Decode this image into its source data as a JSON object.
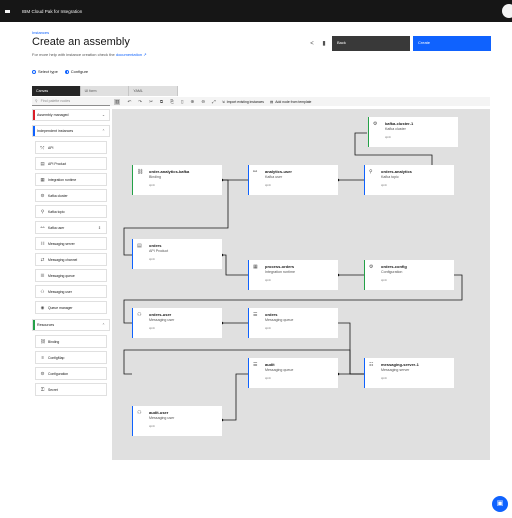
{
  "topbar": {
    "title": "IBM Cloud Pak for Integration"
  },
  "header": {
    "breadcrumb": "Instances",
    "title": "Create an assembly",
    "help_prefix": "For more help with instance creation check the",
    "help_link": "documentation",
    "back_label": "Back",
    "create_label": "Create"
  },
  "steps": [
    {
      "label": "Select type"
    },
    {
      "label": "Configure"
    }
  ],
  "tabs": [
    {
      "label": "Canvas"
    },
    {
      "label": "UI form"
    },
    {
      "label": "YAML"
    }
  ],
  "toolbar": {
    "search_placeholder": "Find palette nodes",
    "import_label": "Import existing instances",
    "add_template_label": "Add node from template"
  },
  "palette": {
    "assembly_managed": "Assembly managed",
    "independent_instances": "Independent instances",
    "independent_items": [
      {
        "label": "API",
        "icon": "api-icon"
      },
      {
        "label": "API Product",
        "icon": "api-product-icon"
      },
      {
        "label": "Integration runtime",
        "icon": "integration-runtime-icon"
      },
      {
        "label": "Kafka cluster",
        "icon": "kafka-cluster-icon"
      },
      {
        "label": "Kafka topic",
        "icon": "kafka-topic-icon"
      },
      {
        "label": "Kafka user",
        "icon": "kafka-user-icon"
      },
      {
        "label": "Messaging server",
        "icon": "messaging-server-icon"
      },
      {
        "label": "Messaging channel",
        "icon": "messaging-channel-icon"
      },
      {
        "label": "Messaging queue",
        "icon": "messaging-queue-icon"
      },
      {
        "label": "Messaging user",
        "icon": "messaging-user-icon"
      },
      {
        "label": "Queue manager",
        "icon": "queue-manager-icon"
      }
    ],
    "resources": "Resources",
    "resource_items": [
      {
        "label": "Binding",
        "icon": "binding-icon"
      },
      {
        "label": "ConfigMap",
        "icon": "configmap-icon"
      },
      {
        "label": "Configuration",
        "icon": "configuration-icon"
      },
      {
        "label": "Secret",
        "icon": "secret-icon"
      }
    ]
  },
  "nodes": {
    "kafka_cluster_1": {
      "name": "kafka-cluster-1",
      "type": "Kafka cluster",
      "sub": "cp4i"
    },
    "order_analytics_kafka": {
      "name": "order-analytics-kafka",
      "type": "Binding",
      "sub": "cp4i"
    },
    "analytics_user": {
      "name": "analytics-user",
      "type": "Kafka user",
      "sub": "cp4i"
    },
    "orders_analytics": {
      "name": "orders-analytics",
      "type": "Kafka topic",
      "sub": "cp4i"
    },
    "orders_api": {
      "name": "orders",
      "type": "API Product",
      "sub": "cp4i"
    },
    "process_orders": {
      "name": "process-orders",
      "type": "Integration runtime",
      "sub": "cp4i"
    },
    "orders_config": {
      "name": "orders-config",
      "type": "Configuration",
      "sub": "cp4i"
    },
    "orders_user": {
      "name": "orders-user",
      "type": "Messaging user",
      "sub": "cp4i"
    },
    "orders_queue": {
      "name": "orders",
      "type": "Messaging queue",
      "sub": "cp4i"
    },
    "audit_queue": {
      "name": "audit",
      "type": "Messaging queue",
      "sub": "cp4i"
    },
    "messaging_server_1": {
      "name": "messaging-server-1",
      "type": "Messaging server",
      "sub": "cp4i"
    },
    "audit_user": {
      "name": "audit-user",
      "type": "Messaging user",
      "sub": "cp4i"
    }
  },
  "colors": {
    "accent": "#0f62fe",
    "topbar": "#161616",
    "canvas": "#e0e0e0",
    "node_green": "#24a148",
    "assembly_red": "#da1e28"
  }
}
